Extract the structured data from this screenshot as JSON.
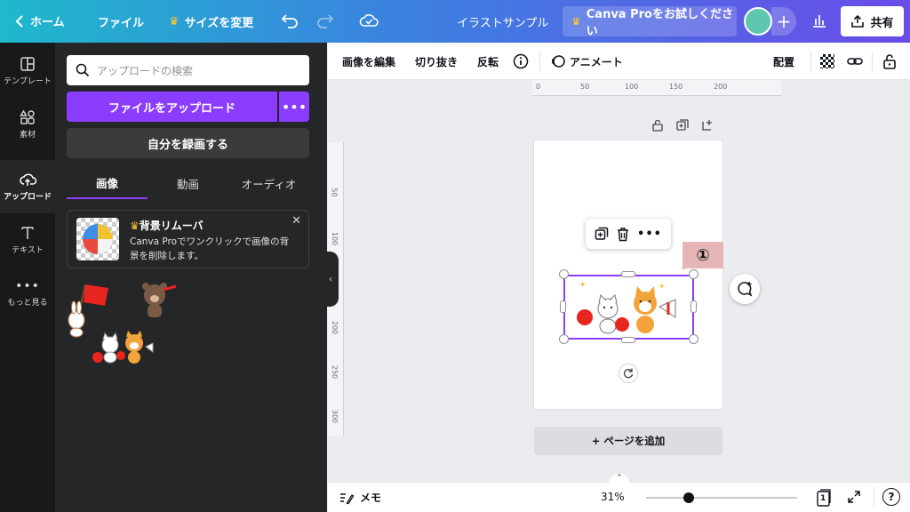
{
  "topbar": {
    "back_label": "ホーム",
    "file_label": "ファイル",
    "resize_label": "サイズを変更",
    "doc_title": "イラストサンプル",
    "pro_label": "Canva Proをお試しください",
    "share_label": "共有",
    "icons": {
      "back": "chevron-left-icon",
      "crown": "crown-icon",
      "undo": "undo-icon",
      "redo": "redo-icon",
      "cloud": "cloud-check-icon",
      "insights": "bar-chart-icon",
      "share": "upload-icon"
    }
  },
  "rail": {
    "items": [
      {
        "label": "テンプレート",
        "icon": "layout-icon"
      },
      {
        "label": "素材",
        "icon": "shapes-icon"
      },
      {
        "label": "アップロード",
        "icon": "cloud-upload-icon"
      },
      {
        "label": "テキスト",
        "icon": "text-icon"
      },
      {
        "label": "もっと見る",
        "icon": "more-icon"
      }
    ]
  },
  "panel": {
    "search_placeholder": "アップロードの検索",
    "upload_button": "ファイルをアップロード",
    "more_button": "•••",
    "record_button": "自分を録画する",
    "tabs": [
      "画像",
      "動画",
      "オーディオ"
    ],
    "card": {
      "title": "背景リムーバ",
      "body": "Canva Proでワンクリックで画像の背景を削除します。",
      "close": "✕"
    }
  },
  "toolbar": {
    "edit_image": "画像を編集",
    "crop": "切り抜き",
    "flip": "反転",
    "animate": "アニメート",
    "position": "配置"
  },
  "ruler": {
    "h_ticks": [
      "0",
      "50",
      "100",
      "150",
      "200"
    ],
    "v_ticks": [
      "50",
      "100",
      "150",
      "200",
      "250",
      "300"
    ]
  },
  "canvas": {
    "marker_label": "①",
    "add_page": "+ ページを追加"
  },
  "bottombar": {
    "notes_label": "メモ",
    "zoom": "31%",
    "zoom_fraction": 0.28,
    "page_count": "1",
    "help": "?"
  },
  "colors": {
    "accent": "#8b3dff",
    "panel_bg": "#252627",
    "rail_bg": "#18191b"
  }
}
